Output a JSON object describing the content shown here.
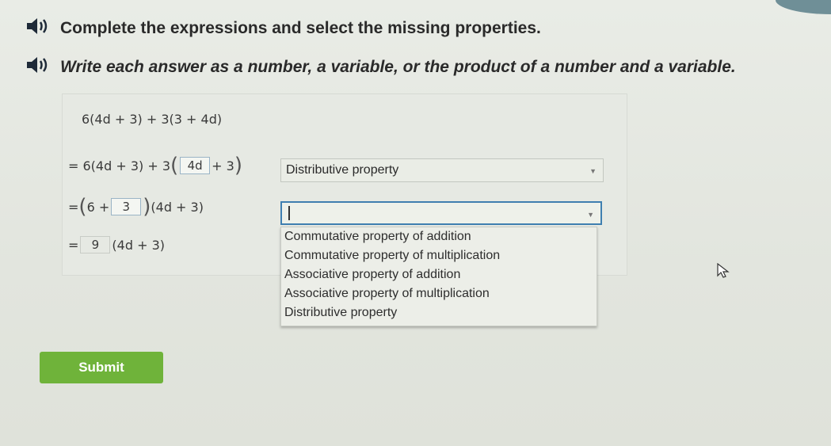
{
  "instructions": {
    "line1": "Complete the expressions and select the missing properties.",
    "line2": "Write each answer as a number, a variable, or the product of a number and a variable."
  },
  "icons": {
    "audio": "speaker-icon",
    "dropdown": "chevron-down-icon",
    "mouse": "pointer-icon"
  },
  "expressions": {
    "line1": "6(4d + 3) + 3(3 + 4d)",
    "line2_prefix": "= 6(4d + 3) + 3",
    "line2_input": "4d",
    "line2_suffix": "+ 3",
    "line3_prefix": "= ",
    "line3_inner_start": "6 +",
    "line3_input": "3",
    "line3_suffix": "(4d + 3)",
    "line4_prefix": "=",
    "line4_input": "9",
    "line4_suffix": "(4d + 3)"
  },
  "selects": {
    "first_value": "Distributive property",
    "second_value": ""
  },
  "dropdown_options": [
    "Commutative property of addition",
    "Commutative property of multiplication",
    "Associative property of addition",
    "Associative property of multiplication",
    "Distributive property"
  ],
  "submit_label": "Submit",
  "colors": {
    "submit": "#6fb33a",
    "focus_border": "#3f7fb0"
  }
}
